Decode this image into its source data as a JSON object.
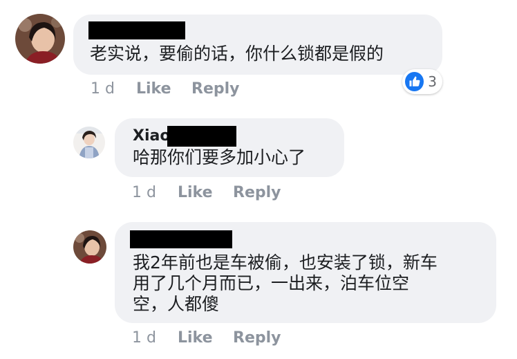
{
  "comments": [
    {
      "author": "",
      "text_lines": [
        "老实说，要偷的话，你什么锁都是假的"
      ],
      "time": "1 d",
      "like_label": "Like",
      "reply_label": "Reply",
      "reaction_count": "3"
    },
    {
      "author": "Xiao",
      "text_lines": [
        "哈那你们要多加小心了"
      ],
      "time": "1 d",
      "like_label": "Like",
      "reply_label": "Reply"
    },
    {
      "author": "",
      "text_lines": [
        "我2年前也是车被偷，也安装了锁，新车",
        "用了几个月而已，一出来，泊车位空",
        "空，人都傻"
      ],
      "time": "1 d",
      "like_label": "Like",
      "reply_label": "Reply"
    }
  ],
  "colors": {
    "bubble": "#f0f1f4",
    "meta_text": "#8d949e",
    "like_blue": "#1877f2",
    "redaction": "#000000"
  },
  "icons": {
    "reaction": "thumbs-up-icon"
  }
}
